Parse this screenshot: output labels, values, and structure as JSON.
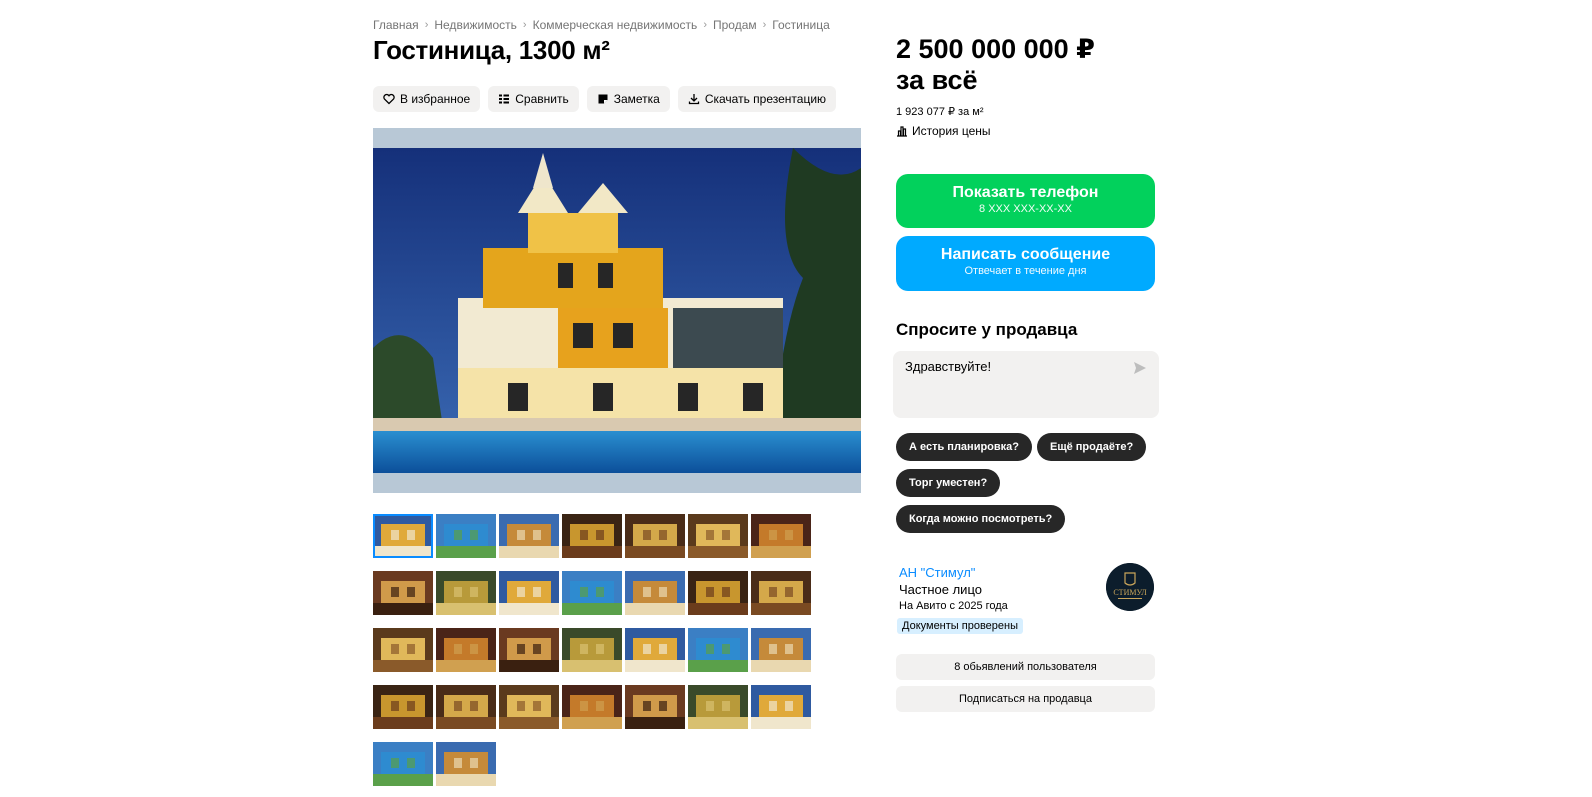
{
  "breadcrumbs": [
    "Главная",
    "Недвижимость",
    "Коммерческая недвижимость",
    "Продам",
    "Гостиница"
  ],
  "title": "Гостиница, 1300 м²",
  "actions": {
    "favorite": "В избранное",
    "compare": "Сравнить",
    "note": "Заметка",
    "download": "Скачать презентацию"
  },
  "price": {
    "amount": "2 500 000 000 ₽",
    "suffix": "за всё",
    "per_meter": "1 923 077 ₽ за м²",
    "history": "История цены"
  },
  "contact": {
    "phone_label": "Показать телефон",
    "phone_mask": "8 XXX XXX-XX-XX",
    "message_label": "Написать сообщение",
    "message_sub": "Отвечает в течение дня"
  },
  "ask": {
    "title": "Спросите у продавца",
    "input_value": "Здравствуйте!",
    "questions": [
      "А есть планировка?",
      "Ещё продаёте?",
      "Торг уместен?",
      "Когда можно посмотреть?"
    ]
  },
  "seller": {
    "name": "АН \"Стимул\"",
    "type": "Частное лицо",
    "since": "На Авито с 2025 года",
    "badge": "Документы проверены",
    "logo_text": "СТИМУЛ",
    "listings": "8 обьявлений пользователя",
    "subscribe": "Подписаться на продавца"
  },
  "photos": {
    "count": 30,
    "selected_index": 0
  },
  "colors": {
    "phone_button": "#02d15c",
    "message_button": "#00aaff",
    "link": "#0a8cff",
    "dark_chip": "#272727"
  }
}
